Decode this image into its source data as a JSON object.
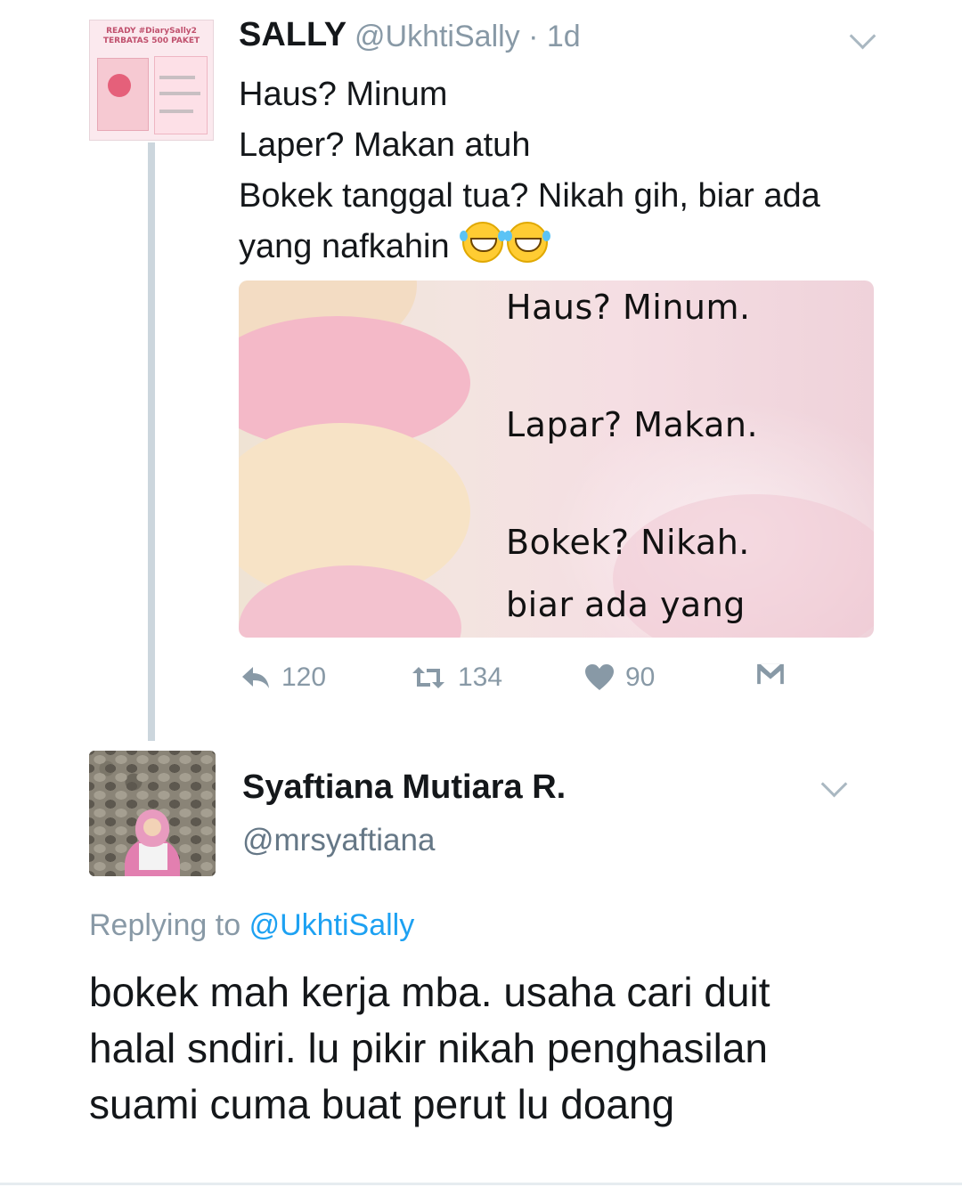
{
  "tweet": {
    "avatar_text": [
      "READY #DiarySally2",
      "TERBATAS 500 PAKET"
    ],
    "name": "SALLY",
    "handle_time": "@UkhtiSally · 1d",
    "text_lines": [
      "Haus? Minum",
      "Laper? Makan atuh",
      "Bokek tanggal tua? Nikah gih, biar ada",
      "yang nafkahin"
    ],
    "emojis": [
      "grinning-tears-emoji",
      "grinning-tears-emoji"
    ],
    "media": {
      "lines": [
        "Haus? Minum.",
        "Lapar? Makan.",
        "Bokek? Nikah.",
        "biar ada yang"
      ]
    },
    "actions": {
      "reply_count": "120",
      "retweet_count": "134",
      "like_count": "90"
    }
  },
  "reply": {
    "name": "Syaftiana Mutiara R.",
    "handle": "@mrsyaftiana",
    "replying_prefix": "Replying to",
    "replying_to": "@UkhtiSally",
    "text_lines": [
      "bokek mah kerja mba. usaha cari duit",
      "halal sndiri. lu pikir nikah penghasilan",
      "suami cuma buat perut lu doang"
    ]
  },
  "colors": {
    "name": "#14171a",
    "muted": "#8899a6",
    "link": "#1da1f2",
    "thread_line": "#ccd6dd"
  }
}
